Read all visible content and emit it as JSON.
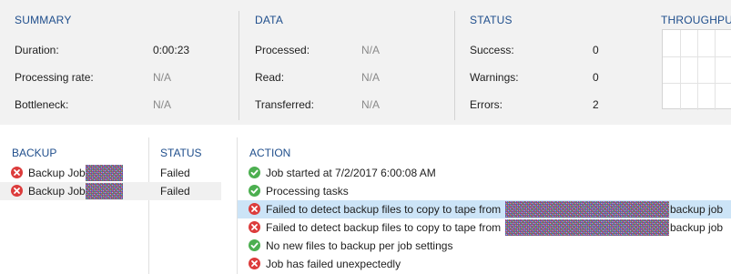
{
  "summary": {
    "title": "SUMMARY",
    "rows": [
      {
        "label": "Duration:",
        "value": "0:00:23"
      },
      {
        "label": "Processing rate:",
        "value": "N/A"
      },
      {
        "label": "Bottleneck:",
        "value": "N/A"
      }
    ]
  },
  "data_section": {
    "title": "DATA",
    "rows": [
      {
        "label": "Processed:",
        "value": "N/A"
      },
      {
        "label": "Read:",
        "value": "N/A"
      },
      {
        "label": "Transferred:",
        "value": "N/A"
      }
    ]
  },
  "status_section": {
    "title": "STATUS",
    "rows": [
      {
        "label": "Success:",
        "value": "0"
      },
      {
        "label": "Warnings:",
        "value": "0"
      },
      {
        "label": "Errors:",
        "value": "2"
      }
    ]
  },
  "throughput": {
    "title": "THROUGHPUT"
  },
  "backup_list": {
    "col_backup": "BACKUP",
    "col_status": "STATUS",
    "items": [
      {
        "name": "Backup Job",
        "status": "Failed",
        "icon": "error-icon"
      },
      {
        "name": "Backup Job",
        "status": "Failed",
        "icon": "error-icon"
      }
    ]
  },
  "action_log": {
    "col_action": "ACTION",
    "items": [
      {
        "text": "Job started at 7/2/2017 6:00:08 AM",
        "icon": "success-icon"
      },
      {
        "text": "Processing tasks",
        "icon": "success-icon"
      },
      {
        "text": "Failed to detect backup files to copy to tape from",
        "suffix": "backup job",
        "icon": "error-icon"
      },
      {
        "text": "Failed to detect backup files to copy to tape from",
        "suffix": "backup job",
        "icon": "error-icon"
      },
      {
        "text": "No new files to backup per job settings",
        "icon": "success-icon"
      },
      {
        "text": "Job has failed unexpectedly",
        "icon": "error-icon"
      }
    ]
  },
  "colors": {
    "header_text": "#1f4e8c",
    "error": "#dc3c3c",
    "success": "#4caf50",
    "selected_row": "#cce4f7",
    "top_panel_bg": "#f2f2f2"
  }
}
